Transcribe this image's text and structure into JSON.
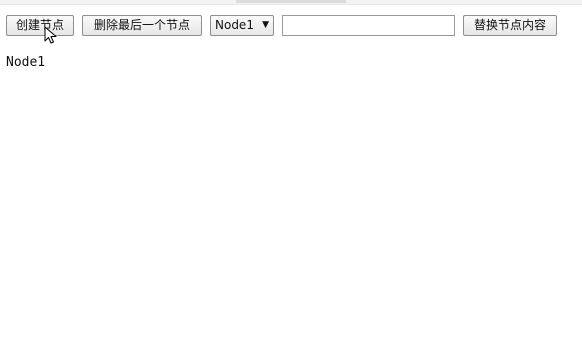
{
  "toolbar": {
    "create_label": "创建节点",
    "delete_last_label": "删除最后一个节点",
    "selected_node": "Node1",
    "replace_input_value": "",
    "replace_label": "替换节点内容"
  },
  "content": {
    "nodes": [
      "Node1"
    ]
  },
  "icons": {
    "select_arrow": "▼",
    "pointer": "mouse-pointer-icon"
  }
}
